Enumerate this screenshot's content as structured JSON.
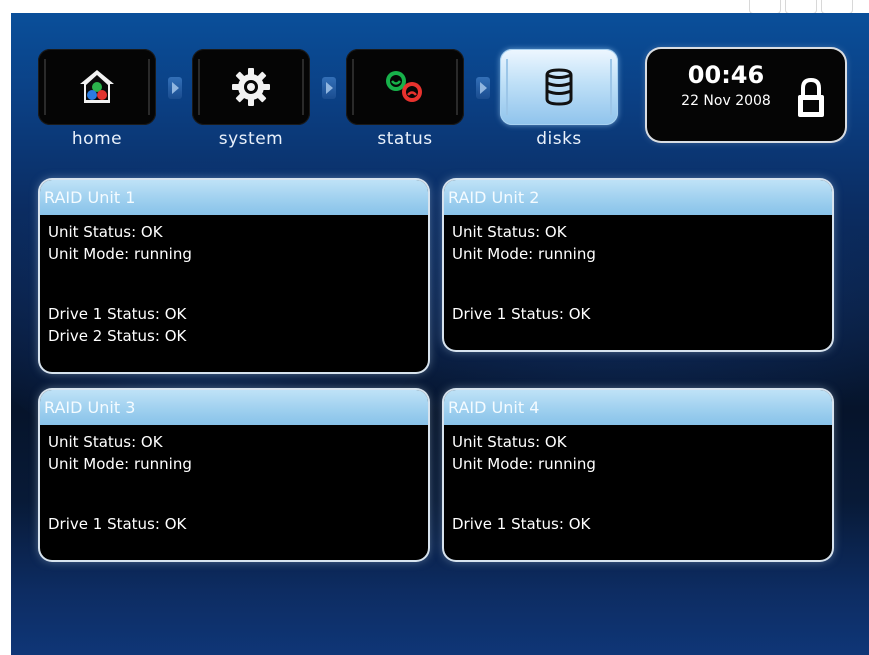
{
  "nav": {
    "items": [
      {
        "label": "home",
        "icon": "home-icon"
      },
      {
        "label": "system",
        "icon": "gear-icon"
      },
      {
        "label": "status",
        "icon": "status-icon"
      },
      {
        "label": "disks",
        "icon": "database-icon",
        "active": true
      }
    ]
  },
  "clock": {
    "time": "00:46",
    "date": "22 Nov 2008",
    "icon": "lock-icon"
  },
  "units": [
    {
      "title": "RAID Unit 1",
      "status": "Unit Status: OK",
      "mode": "Unit Mode:  running",
      "drives": [
        "Drive 1 Status: OK",
        "Drive 2 Status: OK"
      ]
    },
    {
      "title": "RAID Unit 2",
      "status": "Unit Status: OK",
      "mode": "Unit Mode:  running",
      "drives": [
        "Drive 1 Status: OK"
      ]
    },
    {
      "title": "RAID Unit 3",
      "status": "Unit Status: OK",
      "mode": "Unit Mode:  running",
      "drives": [
        "Drive 1 Status: OK"
      ]
    },
    {
      "title": "RAID Unit 4",
      "status": "Unit Status: OK",
      "mode": "Unit Mode:  running",
      "drives": [
        "Drive 1 Status: OK"
      ]
    }
  ],
  "colors": {
    "panel_header": "#9fd0ef",
    "background": "#0a2147",
    "status_ok_green": "#17b14a",
    "status_bad_red": "#e8322e"
  }
}
